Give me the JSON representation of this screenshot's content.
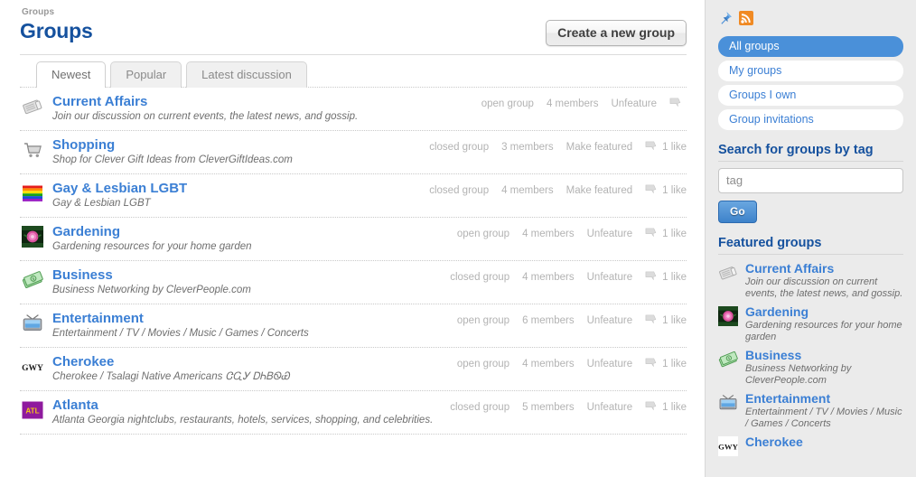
{
  "breadcrumb": "Groups",
  "page_title": "Groups",
  "create_button": "Create a new group",
  "tabs": [
    {
      "label": "Newest",
      "active": true
    },
    {
      "label": "Popular",
      "active": false
    },
    {
      "label": "Latest discussion",
      "active": false
    }
  ],
  "groups": [
    {
      "name": "Current Affairs",
      "desc": "Join our discussion on current events, the latest news, and gossip.",
      "privacy": "open group",
      "members": "4 members",
      "feature_action": "Unfeature",
      "likes": "",
      "icon": "newspaper-icon"
    },
    {
      "name": "Shopping",
      "desc": "Shop for Clever Gift Ideas from CleverGiftIdeas.com",
      "privacy": "closed group",
      "members": "3 members",
      "feature_action": "Make featured",
      "likes": "1 like",
      "icon": "shopping-cart-icon"
    },
    {
      "name": "Gay & Lesbian LGBT",
      "desc": "Gay & Lesbian LGBT",
      "privacy": "closed group",
      "members": "4 members",
      "feature_action": "Make featured",
      "likes": "1 like",
      "icon": "rainbow-flag-icon"
    },
    {
      "name": "Gardening",
      "desc": "Gardening resources for your home garden",
      "privacy": "open group",
      "members": "4 members",
      "feature_action": "Unfeature",
      "likes": "1 like",
      "icon": "flower-icon"
    },
    {
      "name": "Business",
      "desc": "Business Networking by CleverPeople.com",
      "privacy": "closed group",
      "members": "4 members",
      "feature_action": "Unfeature",
      "likes": "1 like",
      "icon": "money-icon"
    },
    {
      "name": "Entertainment",
      "desc": "Entertainment / TV / Movies / Music / Games / Concerts",
      "privacy": "open group",
      "members": "6 members",
      "feature_action": "Unfeature",
      "likes": "1 like",
      "icon": "television-icon"
    },
    {
      "name": "Cherokee",
      "desc": "Cherokee / Tsalagi Native Americans ᏣᏩᎩ ᎠᏂᏴᏫᏯ",
      "privacy": "open group",
      "members": "4 members",
      "feature_action": "Unfeature",
      "likes": "1 like",
      "icon": "cherokee-syllabary-icon"
    },
    {
      "name": "Atlanta",
      "desc": "Atlanta Georgia nightclubs, restaurants, hotels, services, shopping, and celebrities.",
      "privacy": "closed group",
      "members": "5 members",
      "feature_action": "Unfeature",
      "likes": "1 like",
      "icon": "atlanta-badge-icon"
    }
  ],
  "sidebar": {
    "nav": [
      {
        "label": "All groups",
        "active": true
      },
      {
        "label": "My groups",
        "active": false
      },
      {
        "label": "Groups I own",
        "active": false
      },
      {
        "label": "Group invitations",
        "active": false
      }
    ],
    "search_heading": "Search for groups by tag",
    "search_placeholder": "tag",
    "search_value": "",
    "go_label": "Go",
    "featured_heading": "Featured groups",
    "featured": [
      {
        "name": "Current Affairs",
        "desc": "Join our discussion on current events, the latest news, and gossip.",
        "icon": "newspaper-icon"
      },
      {
        "name": "Gardening",
        "desc": "Gardening resources for your home garden",
        "icon": "flower-icon"
      },
      {
        "name": "Business",
        "desc": "Business Networking by CleverPeople.com",
        "icon": "money-icon"
      },
      {
        "name": "Entertainment",
        "desc": "Entertainment / TV / Movies / Music / Games / Concerts",
        "icon": "television-icon"
      },
      {
        "name": "Cherokee",
        "desc": "",
        "icon": "cherokee-syllabary-icon"
      }
    ]
  },
  "colors": {
    "heading_blue": "#15519e",
    "link_blue": "#3b7fd4",
    "active_pill": "#4a90d9",
    "sidebar_bg": "#ebebeb",
    "rss_orange": "#f08a24"
  }
}
